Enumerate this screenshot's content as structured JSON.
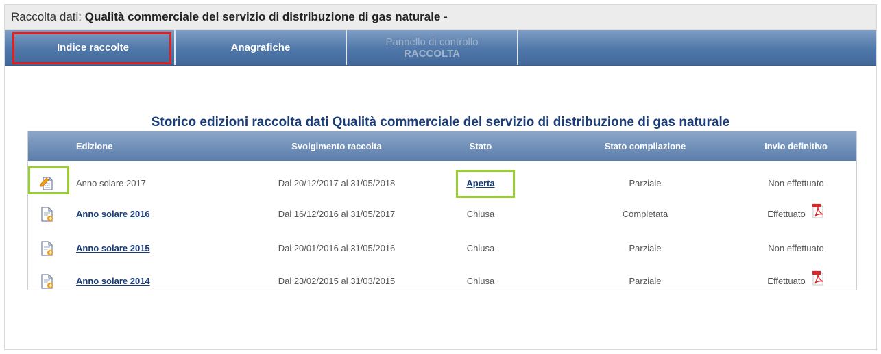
{
  "window": {
    "title_prefix": "Raccolta dati: ",
    "title_main": "Qualità commerciale del servizio di distribuzione di gas naturale -"
  },
  "nav": {
    "tabs": [
      {
        "label": "Indice raccolte",
        "state": "active"
      },
      {
        "label": "Anagrafiche",
        "state": "enabled"
      },
      {
        "label_line1": "Pannello di controllo",
        "label_line2": "RACCOLTA",
        "state": "disabled"
      }
    ]
  },
  "main": {
    "heading": "Storico edizioni raccolta dati Qualità commerciale del servizio di distribuzione di gas naturale"
  },
  "table": {
    "headers": {
      "edizione": "Edizione",
      "svolgimento": "Svolgimento raccolta",
      "stato": "Stato",
      "compilazione": "Stato compilazione",
      "invio": "Invio definitivo"
    },
    "rows": [
      {
        "edizione": "Anno solare 2017",
        "svolgimento": "Dal 20/12/2017 al 31/05/2018",
        "stato": "Aperta",
        "compilazione": "Parziale",
        "invio": "Non effettuato",
        "icon": "edit-document-icon"
      },
      {
        "edizione": "Anno solare 2016",
        "svolgimento": "Dal 16/12/2016 al 31/05/2017",
        "stato": "Chiusa",
        "compilazione": "Completata",
        "invio": "Effettuato",
        "icon": "view-document-icon",
        "pdf_icon": "pdf-icon"
      },
      {
        "edizione": "Anno solare 2015",
        "svolgimento": "Dal 20/01/2016 al 31/05/2016",
        "stato": "Chiusa",
        "compilazione": "Parziale",
        "invio": "Non effettuato",
        "icon": "view-document-icon"
      },
      {
        "edizione": "Anno solare 2014",
        "svolgimento": "Dal 23/02/2015 al 31/03/2015",
        "stato": "Chiusa",
        "compilazione": "Parziale",
        "invio": "Effettuato",
        "icon": "view-document-icon",
        "pdf_icon": "pdf-icon"
      }
    ]
  },
  "colors": {
    "nav_blue": "#4f77a9",
    "heading_blue": "#1a3c78",
    "highlight_red": "#e02020",
    "highlight_green": "#98cf2f"
  }
}
